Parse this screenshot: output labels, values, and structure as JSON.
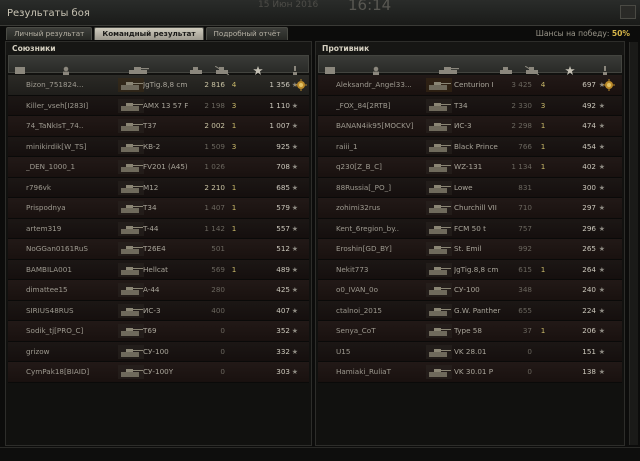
{
  "window": {
    "title": "Результаты боя",
    "clock_small": "15 Июн 2016",
    "clock_big": "16:14"
  },
  "tabs": [
    {
      "label": "Личный результат",
      "active": false
    },
    {
      "label": "Командный результат",
      "active": true
    },
    {
      "label": "Подробный отчёт",
      "active": false
    }
  ],
  "win_chance": {
    "label": "Шансы на победу:",
    "value": "50%"
  },
  "allies": {
    "title": "Союзники",
    "rows": [
      {
        "name": "Bizon_751824...",
        "tank": "JgTig.8,8 cm",
        "dmg": "2 816",
        "kills": "4",
        "xp": "1 356",
        "medal": true,
        "me": true,
        "dim": false
      },
      {
        "name": "Killer_vseh[I283I]",
        "tank": "AMX 13 57 F",
        "dmg": "2 198",
        "kills": "3",
        "xp": "1 110",
        "medal": false,
        "me": false,
        "dim": true
      },
      {
        "name": "74_TaNkIsT_74..",
        "tank": "T37",
        "dmg": "2 002",
        "kills": "1",
        "xp": "1 007",
        "medal": false,
        "me": false,
        "dim": false
      },
      {
        "name": "minikirdik[W_TS]",
        "tank": "КВ-2",
        "dmg": "1 509",
        "kills": "3",
        "xp": "925",
        "medal": false,
        "me": false,
        "dim": true
      },
      {
        "name": "_DEN_1000_1",
        "tank": "FV201 (A45)",
        "dmg": "1 026",
        "kills": "",
        "xp": "708",
        "medal": false,
        "me": false,
        "dim": true
      },
      {
        "name": "r796vk",
        "tank": "M12",
        "dmg": "2 210",
        "kills": "1",
        "xp": "685",
        "medal": false,
        "me": false,
        "dim": false
      },
      {
        "name": "Prispodnya",
        "tank": "T34",
        "dmg": "1 407",
        "kills": "1",
        "xp": "579",
        "medal": false,
        "me": false,
        "dim": true
      },
      {
        "name": "artem319",
        "tank": "T-44",
        "dmg": "1 142",
        "kills": "1",
        "xp": "557",
        "medal": false,
        "me": false,
        "dim": true
      },
      {
        "name": "NoGGan0161RuS",
        "tank": "T26E4",
        "dmg": "501",
        "kills": "",
        "xp": "512",
        "medal": false,
        "me": false,
        "dim": true
      },
      {
        "name": "BAMBILA001",
        "tank": "Hellcat",
        "dmg": "569",
        "kills": "1",
        "xp": "489",
        "medal": false,
        "me": false,
        "dim": true
      },
      {
        "name": "dimattee15",
        "tank": "A-44",
        "dmg": "280",
        "kills": "",
        "xp": "425",
        "medal": false,
        "me": false,
        "dim": true
      },
      {
        "name": "SIRIUS48RUS",
        "tank": "ИС-3",
        "dmg": "400",
        "kills": "",
        "xp": "407",
        "medal": false,
        "me": false,
        "dim": true
      },
      {
        "name": "Sodik_tj[PRO_C]",
        "tank": "T69",
        "dmg": "0",
        "kills": "",
        "xp": "352",
        "medal": false,
        "me": false,
        "dim": true
      },
      {
        "name": "grizow",
        "tank": "СУ-100",
        "dmg": "0",
        "kills": "",
        "xp": "332",
        "medal": false,
        "me": false,
        "dim": true
      },
      {
        "name": "CymPak18[BIAID]",
        "tank": "СУ-100Y",
        "dmg": "0",
        "kills": "",
        "xp": "303",
        "medal": false,
        "me": false,
        "dim": true
      }
    ]
  },
  "enemies": {
    "title": "Противник",
    "rows": [
      {
        "name": "Aleksandr_Angel33...",
        "tank": "Centurion I",
        "dmg": "3 425",
        "kills": "4",
        "xp": "697",
        "medal": true,
        "dim": true
      },
      {
        "name": "_FOX_84[2RTB]",
        "tank": "T34",
        "dmg": "2 330",
        "kills": "3",
        "xp": "492",
        "medal": false,
        "dim": true
      },
      {
        "name": "BANAN4ik95[MOCKV]",
        "tank": "ИС-3",
        "dmg": "2 298",
        "kills": "1",
        "xp": "474",
        "medal": false,
        "dim": true
      },
      {
        "name": "raiii_1",
        "tank": "Black Prince",
        "dmg": "766",
        "kills": "1",
        "xp": "454",
        "medal": false,
        "dim": true
      },
      {
        "name": "q230[Z_B_C]",
        "tank": "WZ-131",
        "dmg": "1 134",
        "kills": "1",
        "xp": "402",
        "medal": false,
        "dim": true
      },
      {
        "name": "88Russia[_PO_]",
        "tank": "Lowe",
        "dmg": "831",
        "kills": "",
        "xp": "300",
        "medal": false,
        "dim": true
      },
      {
        "name": "zohimi32rus",
        "tank": "Churchill VII",
        "dmg": "710",
        "kills": "",
        "xp": "297",
        "medal": false,
        "dim": true
      },
      {
        "name": "Kent_6region_by..",
        "tank": "FCM 50 t",
        "dmg": "757",
        "kills": "",
        "xp": "296",
        "medal": false,
        "dim": true
      },
      {
        "name": "Eroshin[GD_BY]",
        "tank": "St. Emil",
        "dmg": "992",
        "kills": "",
        "xp": "265",
        "medal": false,
        "dim": true
      },
      {
        "name": "Nekit773",
        "tank": "JgTig.8,8 cm",
        "dmg": "615",
        "kills": "1",
        "xp": "264",
        "medal": false,
        "dim": true
      },
      {
        "name": "o0_IVAN_0o",
        "tank": "СУ-100",
        "dmg": "348",
        "kills": "",
        "xp": "240",
        "medal": false,
        "dim": true
      },
      {
        "name": "ctalnoi_2015",
        "tank": "G.W. Panther",
        "dmg": "655",
        "kills": "",
        "xp": "224",
        "medal": false,
        "dim": true
      },
      {
        "name": "Senya_CoT",
        "tank": "Type 58",
        "dmg": "37",
        "kills": "1",
        "xp": "206",
        "medal": false,
        "dim": true
      },
      {
        "name": "U15",
        "tank": "VK 28.01",
        "dmg": "0",
        "kills": "",
        "xp": "151",
        "medal": false,
        "dim": true
      },
      {
        "name": "Hamiaki_RuliaT",
        "tank": "VK 30.01 P",
        "dmg": "0",
        "kills": "",
        "xp": "138",
        "medal": false,
        "dim": true
      }
    ]
  },
  "icons": {
    "col_platoon": "platoon-icon",
    "col_player": "player-icon",
    "col_tank": "tank-icon",
    "col_damage": "damage-icon",
    "col_frags": "frags-icon",
    "col_xp": "star-icon",
    "col_medal": "medal-icon"
  },
  "colors": {
    "accent": "#d7b649",
    "xp_star": "#8d8a82"
  }
}
